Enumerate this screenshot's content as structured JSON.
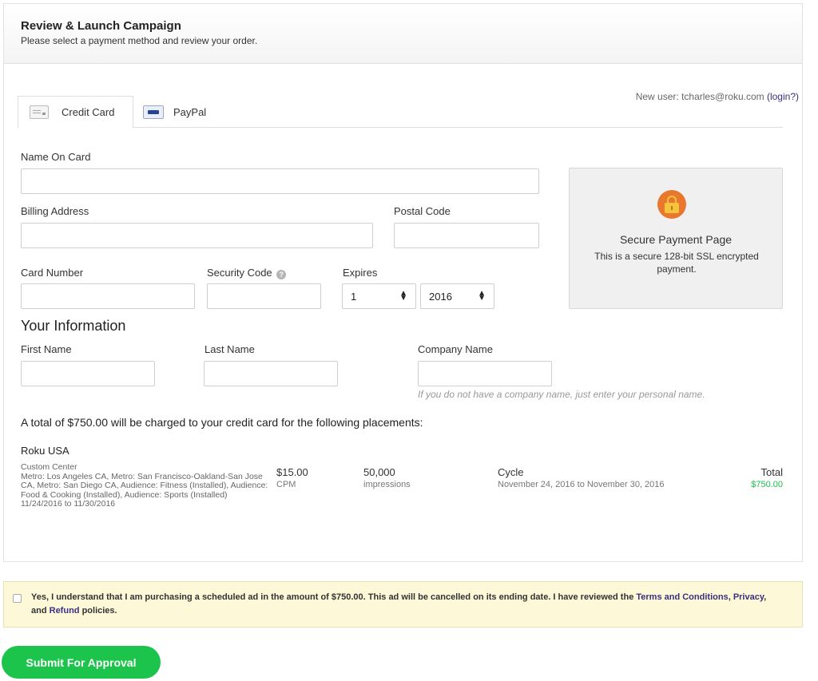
{
  "header": {
    "title": "Review & Launch Campaign",
    "subtitle": "Please select a payment method and review your order."
  },
  "user": {
    "prefix": "New user: tcharles@roku.com",
    "login_link": "(login?)"
  },
  "tabs": [
    {
      "label": "Credit Card",
      "icon": "credit-card-icon",
      "active": true
    },
    {
      "label": "PayPal",
      "icon": "paypal-icon",
      "active": false
    }
  ],
  "payment_form": {
    "name_on_card_label": "Name On Card",
    "name_on_card_value": "",
    "billing_address_label": "Billing Address",
    "billing_address_value": "",
    "postal_code_label": "Postal Code",
    "postal_code_value": "",
    "card_number_label": "Card Number",
    "card_number_value": "",
    "security_code_label": "Security Code",
    "security_code_value": "",
    "expires_label": "Expires",
    "expires_month": "1",
    "expires_year": "2016"
  },
  "secure": {
    "title": "Secure Payment Page",
    "description": "This is a secure 128-bit SSL encrypted payment."
  },
  "your_info": {
    "heading": "Your Information",
    "first_name_label": "First Name",
    "last_name_label": "Last Name",
    "company_label": "Company Name",
    "company_hint": "If you do not have a company name, just enter your personal name."
  },
  "order": {
    "charge_text": "A total of $750.00 will be charged to your credit card for the following placements:",
    "placement_name": "Roku USA",
    "placement_desc": "Custom Center\nMetro: Los Angeles CA, Metro: San Francisco-Oakland-San Jose CA, Metro: San Diego CA, Audience: Fitness (Installed), Audience: Food & Cooking (Installed), Audience: Sports (Installed) 11/24/2016 to 11/30/2016",
    "price": "$15.00",
    "price_unit": "CPM",
    "impressions": "50,000",
    "impressions_unit": "impressions",
    "cycle_label": "Cycle",
    "cycle_value": "November 24, 2016 to November 30, 2016",
    "total_label": "Total",
    "total_value": "$750.00"
  },
  "agreement": {
    "text_before": "Yes, I understand that I am purchasing a scheduled ad in the amount of $750.00. This ad will be cancelled on its ending date. I have reviewed the ",
    "terms_link": "Terms and Conditions",
    "sep1": ", ",
    "privacy_link": "Privacy",
    "sep2": ", and ",
    "refund_link": "Refund",
    "text_after": " policies."
  },
  "submit_label": "Submit For Approval",
  "colors": {
    "accent_green": "#1dc44b",
    "link_purple": "#3b2f7f",
    "lock_orange": "#e8782e",
    "agreement_bg": "#fcf8d8"
  }
}
